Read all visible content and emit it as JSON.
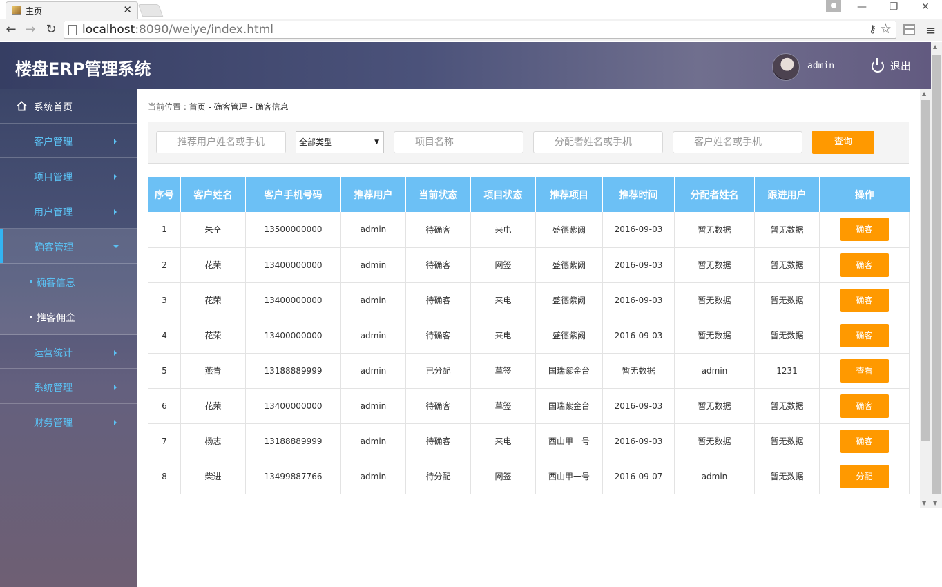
{
  "browser": {
    "tab_title": "主页",
    "tab_close": "✕",
    "url_host": "localhost",
    "url_path": ":8090/weiye/index.html",
    "window_controls": [
      "—",
      "❐",
      "✕"
    ]
  },
  "header": {
    "app_title": "楼盘ERP管理系统",
    "username": "admin",
    "logout_label": "退出"
  },
  "sidebar": {
    "home": "系统首页",
    "items": [
      {
        "label": "客户管理"
      },
      {
        "label": "项目管理"
      },
      {
        "label": "用户管理"
      },
      {
        "label": "确客管理"
      },
      {
        "label": "运营统计"
      },
      {
        "label": "系统管理"
      },
      {
        "label": "财务管理"
      }
    ],
    "sub_items": [
      {
        "label": "确客信息"
      },
      {
        "label": "推客佣金"
      }
    ]
  },
  "breadcrumb": {
    "prefix": "当前位置 : ",
    "path": "首页 - 确客管理 - 确客信息"
  },
  "filters": {
    "referrer_placeholder": "推荐用户姓名或手机",
    "type_select": "全部类型",
    "project_placeholder": "项目名称",
    "assigner_placeholder": "分配者姓名或手机",
    "customer_placeholder": "客户姓名或手机",
    "query_button": "查询"
  },
  "table": {
    "columns": [
      "序号",
      "客户姓名",
      "客户手机号码",
      "推荐用户",
      "当前状态",
      "项目状态",
      "推荐项目",
      "推荐时间",
      "分配者姓名",
      "跟进用户",
      "操作"
    ],
    "rows": [
      {
        "no": "1",
        "name": "朱仝",
        "phone": "13500000000",
        "referrer": "admin",
        "status": "待确客",
        "project_status": "来电",
        "project": "盛德紫阙",
        "time": "2016-09-03",
        "assigner": "暂无数据",
        "follower": "暂无数据",
        "action": "确客"
      },
      {
        "no": "2",
        "name": "花荣",
        "phone": "13400000000",
        "referrer": "admin",
        "status": "待确客",
        "project_status": "网签",
        "project": "盛德紫阙",
        "time": "2016-09-03",
        "assigner": "暂无数据",
        "follower": "暂无数据",
        "action": "确客"
      },
      {
        "no": "3",
        "name": "花荣",
        "phone": "13400000000",
        "referrer": "admin",
        "status": "待确客",
        "project_status": "来电",
        "project": "盛德紫阙",
        "time": "2016-09-03",
        "assigner": "暂无数据",
        "follower": "暂无数据",
        "action": "确客"
      },
      {
        "no": "4",
        "name": "花荣",
        "phone": "13400000000",
        "referrer": "admin",
        "status": "待确客",
        "project_status": "来电",
        "project": "盛德紫阙",
        "time": "2016-09-03",
        "assigner": "暂无数据",
        "follower": "暂无数据",
        "action": "确客"
      },
      {
        "no": "5",
        "name": "燕青",
        "phone": "13188889999",
        "referrer": "admin",
        "status": "已分配",
        "project_status": "草签",
        "project": "国瑞紫金台",
        "time": "暂无数据",
        "assigner": "admin",
        "follower": "1231",
        "action": "查看"
      },
      {
        "no": "6",
        "name": "花荣",
        "phone": "13400000000",
        "referrer": "admin",
        "status": "待确客",
        "project_status": "草签",
        "project": "国瑞紫金台",
        "time": "2016-09-03",
        "assigner": "暂无数据",
        "follower": "暂无数据",
        "action": "确客"
      },
      {
        "no": "7",
        "name": "杨志",
        "phone": "13188889999",
        "referrer": "admin",
        "status": "待确客",
        "project_status": "来电",
        "project": "西山甲一号",
        "time": "2016-09-03",
        "assigner": "暂无数据",
        "follower": "暂无数据",
        "action": "确客"
      },
      {
        "no": "8",
        "name": "柴进",
        "phone": "13499887766",
        "referrer": "admin",
        "status": "待分配",
        "project_status": "网签",
        "project": "西山甲一号",
        "time": "2016-09-07",
        "assigner": "admin",
        "follower": "暂无数据",
        "action": "分配"
      }
    ]
  },
  "colors": {
    "accent_blue": "#5bc0f2",
    "table_header": "#6cc0f5",
    "button_orange": "#ff9900"
  },
  "icons": [
    "home-icon",
    "power-icon",
    "avatar",
    "star-icon",
    "key-icon",
    "menu-icon"
  ]
}
